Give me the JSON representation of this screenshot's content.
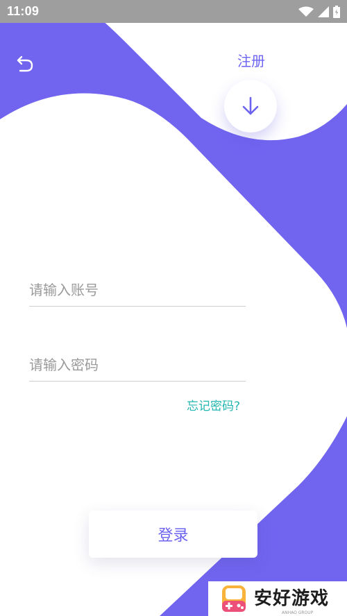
{
  "status_bar": {
    "time": "11:09"
  },
  "header": {
    "register_label": "注册"
  },
  "form": {
    "account_placeholder": "请输入账号",
    "password_placeholder": "请输入密码",
    "forgot_label": "忘记密码?"
  },
  "actions": {
    "login_label": "登录"
  },
  "watermark": {
    "brand_text": "安好游戏",
    "sub_text": "ANHAO GROUP"
  },
  "icons": [
    "back-icon",
    "arrow-down-icon",
    "wifi-icon",
    "signal-icon",
    "battery-icon"
  ],
  "colors": {
    "accent": "#7165f0",
    "link": "#21b6b0",
    "button_text": "#6c63f0",
    "status_bar": "#9e9e9e"
  }
}
